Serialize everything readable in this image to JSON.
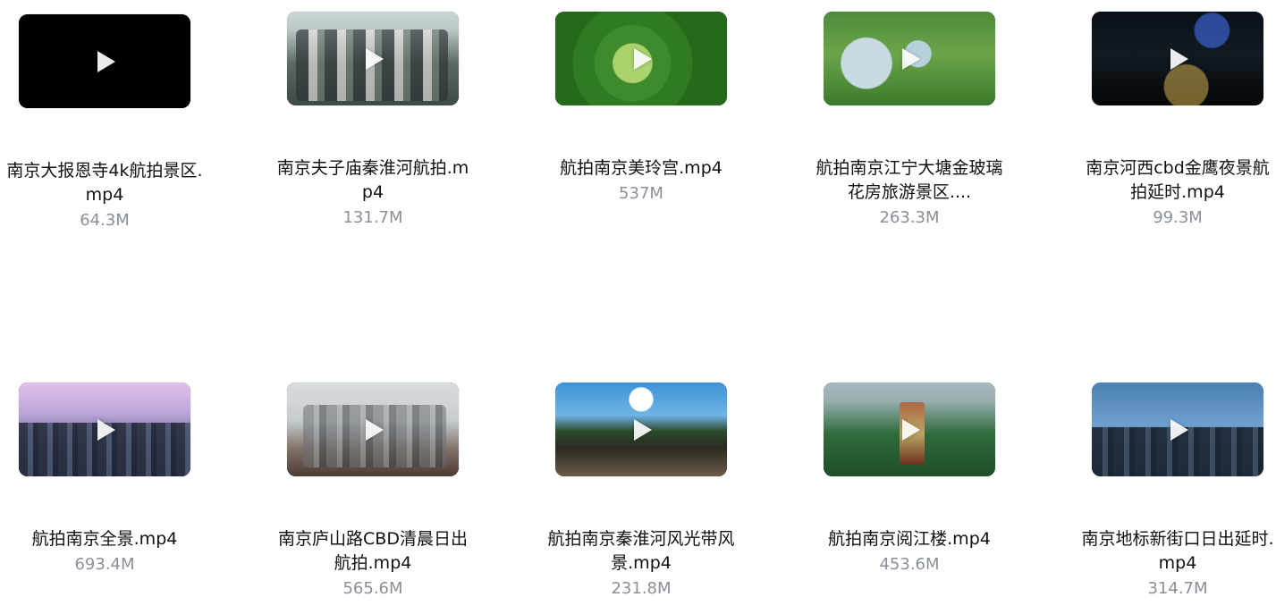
{
  "items": [
    {
      "name": "南京大报恩寺4k航拍景区.mp4",
      "size": "64.3M",
      "thumb_icon": "video-thumbnail"
    },
    {
      "name": "南京夫子庙秦淮河航拍.mp4",
      "size": "131.7M",
      "thumb_icon": "video-thumbnail"
    },
    {
      "name": "航拍南京美玲宫.mp4",
      "size": "537M",
      "thumb_icon": "video-thumbnail"
    },
    {
      "name": "航拍南京江宁大塘金玻璃花房旅游景区....",
      "size": "263.3M",
      "thumb_icon": "video-thumbnail"
    },
    {
      "name": "南京河西cbd金鹰夜景航拍延时.mp4",
      "size": "99.3M",
      "thumb_icon": "video-thumbnail"
    },
    {
      "name": "航拍南京全景.mp4",
      "size": "693.4M",
      "thumb_icon": "video-thumbnail"
    },
    {
      "name": "南京庐山路CBD清晨日出航拍.mp4",
      "size": "565.6M",
      "thumb_icon": "video-thumbnail"
    },
    {
      "name": "航拍南京秦淮河风光带风景.mp4",
      "size": "231.8M",
      "thumb_icon": "video-thumbnail"
    },
    {
      "name": "航拍南京阅江楼.mp4",
      "size": "453.6M",
      "thumb_icon": "video-thumbnail"
    },
    {
      "name": "南京地标新街口日出延时.mp4",
      "size": "314.7M",
      "thumb_icon": "video-thumbnail"
    }
  ],
  "colors": {
    "background": "#ffffff",
    "title": "#111111",
    "size_text": "#8a8f99"
  }
}
